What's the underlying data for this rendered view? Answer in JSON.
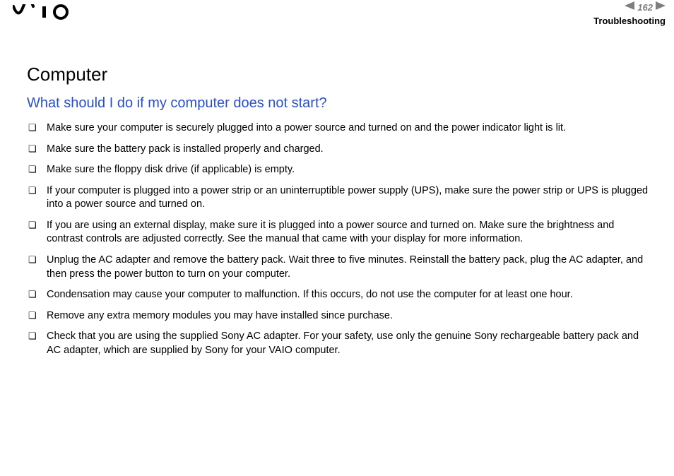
{
  "header": {
    "page_number": "162",
    "section": "Troubleshooting"
  },
  "content": {
    "heading": "Computer",
    "subheading": "What should I do if my computer does not start?",
    "bullets": [
      "Make sure your computer is securely plugged into a power source and turned on and the power indicator light is lit.",
      "Make sure the battery pack is installed properly and charged.",
      "Make sure the floppy disk drive (if applicable) is empty.",
      "If your computer is plugged into a power strip or an uninterruptible power supply (UPS), make sure the power strip or UPS is plugged into a power source and turned on.",
      "If you are using an external display, make sure it is plugged into a power source and turned on. Make sure the brightness and contrast controls are adjusted correctly. See the manual that came with your display for more information.",
      "Unplug the AC adapter and remove the battery pack. Wait three to five minutes. Reinstall the battery pack, plug the AC adapter, and then press the power button to turn on your computer.",
      "Condensation may cause your computer to malfunction. If this occurs, do not use the computer for at least one hour.",
      "Remove any extra memory modules you may have installed since purchase.",
      "Check that you are using the supplied Sony AC adapter. For your safety, use only the genuine Sony rechargeable battery pack and AC adapter, which are supplied by Sony for your VAIO computer."
    ]
  }
}
